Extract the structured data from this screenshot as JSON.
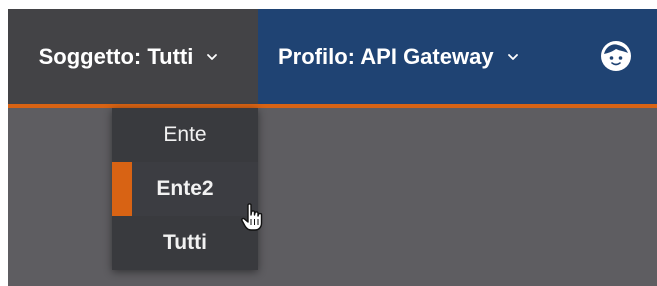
{
  "header": {
    "subject_label": "Soggetto: Tutti",
    "profile_label": "Profilo: API Gateway",
    "user_icon": "user-face-icon"
  },
  "dropdown": {
    "items": [
      {
        "label": "Ente",
        "selected": false
      },
      {
        "label": "Ente2",
        "selected": true
      },
      {
        "label": "Tutti",
        "selected": false
      }
    ]
  },
  "colors": {
    "content_bg": "#5e5d61",
    "subject_bg": "#434346",
    "profile_bg": "#1f4373",
    "accent": "#d86314",
    "dropdown_bg": "#393a3e"
  },
  "icons": {
    "chevron": "chevron-down-icon",
    "cursor": "hand-pointer-icon"
  }
}
